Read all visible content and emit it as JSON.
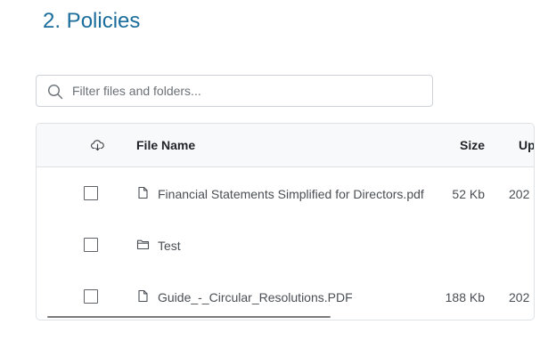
{
  "page": {
    "title": "2. Policies"
  },
  "search": {
    "placeholder": "Filter files and folders...",
    "value": "",
    "icon": "search-icon"
  },
  "table": {
    "columns": {
      "download_icon": "cloud-download-icon",
      "file_name": "File Name",
      "size": "Size",
      "updated": "Up"
    },
    "rows": [
      {
        "type": "file",
        "icon": "file-icon",
        "name": "Financial Statements Simplified for Directors.pdf",
        "size": "52 Kb",
        "updated": "202"
      },
      {
        "type": "folder",
        "icon": "folder-icon",
        "name": "Test",
        "size": "",
        "updated": ""
      },
      {
        "type": "file",
        "icon": "file-icon",
        "name": "Guide_-_Circular_Resolutions.PDF",
        "size": "188 Kb",
        "updated": "202"
      }
    ]
  },
  "colors": {
    "title": "#1b6d9c",
    "header_bg": "#f8f9fa",
    "border": "#dfe2e5",
    "text": "#4a4f55"
  }
}
